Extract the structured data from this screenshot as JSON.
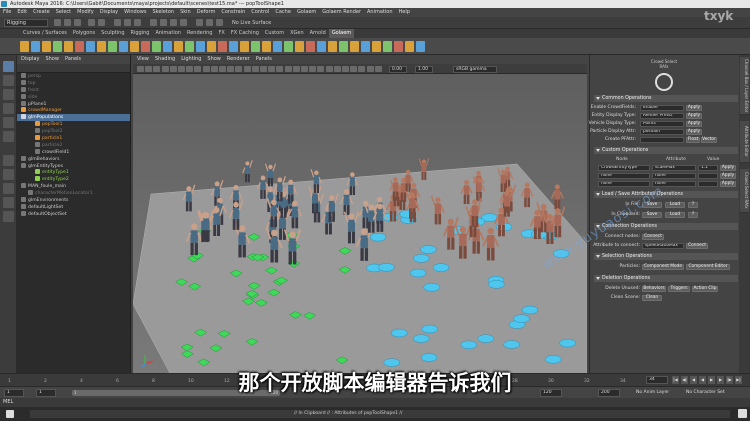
{
  "app": {
    "title": "Autodesk Maya 2016: C:\\Users\\Gabit\\Documents\\maya\\projects\\default\\scenes\\test15.ma* --- popToolShape1"
  },
  "menubar": [
    "File",
    "Edit",
    "Create",
    "Select",
    "Modify",
    "Display",
    "Windows",
    "Skeleton",
    "Skin",
    "Deform",
    "Constrain",
    "Control",
    "Cache",
    "Golaem",
    "Golaem Render",
    "Animation",
    "Help"
  ],
  "status_line": {
    "mode": "Rigging",
    "live_surface": "No Live Surface"
  },
  "shelf_tabs": [
    "Curves / Surfaces",
    "Polygons",
    "Sculpting",
    "Rigging",
    "Animation",
    "Rendering",
    "FX",
    "FX Caching",
    "Custom",
    "XGen",
    "Arnold",
    "Golaem"
  ],
  "shelf_active": "Golaem",
  "outliner": {
    "menu": [
      "Display",
      "Show",
      "Panels"
    ],
    "items": [
      {
        "label": "persp",
        "indent": 0,
        "style": "dim"
      },
      {
        "label": "top",
        "indent": 0,
        "style": "dim"
      },
      {
        "label": "front",
        "indent": 0,
        "style": "dim"
      },
      {
        "label": "side",
        "indent": 0,
        "style": "dim"
      },
      {
        "label": "pPlane1",
        "indent": 0,
        "style": ""
      },
      {
        "label": "crowdManager",
        "indent": 0,
        "style": "orange"
      },
      {
        "label": "glmPopulations",
        "indent": 0,
        "style": "hl"
      },
      {
        "label": "popTool1",
        "indent": 2,
        "style": "orange"
      },
      {
        "label": "popTool2",
        "indent": 2,
        "style": "dim"
      },
      {
        "label": "particle1",
        "indent": 2,
        "style": "orange"
      },
      {
        "label": "particle2",
        "indent": 2,
        "style": "dim"
      },
      {
        "label": "crowdField1",
        "indent": 2,
        "style": ""
      },
      {
        "label": "glmBehaviors",
        "indent": 0,
        "style": ""
      },
      {
        "label": "glmEntityTypes",
        "indent": 0,
        "style": ""
      },
      {
        "label": "entityType1",
        "indent": 2,
        "style": "green"
      },
      {
        "label": "entityType2",
        "indent": 2,
        "style": "green"
      },
      {
        "label": "MAN_foule_main",
        "indent": 0,
        "style": ""
      },
      {
        "label": "characterMotionLocator1",
        "indent": 1,
        "style": "dim"
      },
      {
        "label": "glmEnvironments",
        "indent": 0,
        "style": ""
      },
      {
        "label": "defaultLightSet",
        "indent": 0,
        "style": ""
      },
      {
        "label": "defaultObjectSet",
        "indent": 0,
        "style": ""
      }
    ]
  },
  "viewport": {
    "menu": [
      "View",
      "Shading",
      "Lighting",
      "Show",
      "Renderer",
      "Panels"
    ],
    "field_a": "0.00",
    "field_b": "1.00",
    "color_space": "sRGB gamma"
  },
  "crowd_panel": {
    "logo_caption": "Crowd Select RAfx",
    "common_operations": {
      "title": "Common Operations",
      "enable_crowdfields": {
        "label": "Enable CrowdFields:",
        "value": "Enable",
        "button": "Apply"
      },
      "entity_display_type": {
        "label": "Entity Display Type:",
        "value": "Render Previz",
        "button": "Apply"
      },
      "vehicle_display_type": {
        "label": "Vehicle Display Type:",
        "value": "Points",
        "button": "Apply"
      },
      "particle_display_attr": {
        "label": "Particle Display Attr:",
        "value": "position",
        "button": "Apply"
      },
      "create_pfattr": {
        "label": "Create PFAttr:",
        "btn_float": "Float",
        "btn_vector": "Vector"
      }
    },
    "custom_operations": {
      "title": "Custom Operations",
      "col_node": "Node",
      "col_attribute": "Attribute",
      "col_value": "Value",
      "rows": [
        {
          "node": "CrowdEntityType",
          "attribute": "scaleMax",
          "value": "1.1",
          "button": "Apply"
        },
        {
          "node": "none",
          "attribute": "none",
          "value": "",
          "button": "Apply"
        },
        {
          "node": "none",
          "attribute": "none",
          "value": "",
          "button": "Apply"
        }
      ]
    },
    "load_save": {
      "title": "Load / Save Attributes Operations",
      "in_file": {
        "label": "In File:",
        "save": "Save",
        "load": "Load",
        "help": "?"
      },
      "in_clipboard": {
        "label": "In Clipboard:",
        "save": "Save",
        "load": "Load",
        "help": "?"
      }
    },
    "connection_operations": {
      "title": "Connection Operations",
      "connect_nodes": {
        "label": "Connect nodes:",
        "button": "Connect"
      },
      "attribute_to_connect": {
        "label": "Attribute to connect:",
        "value": "speedRatioMax",
        "button": "Connect"
      }
    },
    "selection_operations": {
      "title": "Selection Operations",
      "particles": {
        "label": "Particles:",
        "btn_component": "Component Mode",
        "btn_editor": "Component Editor"
      }
    },
    "deletion_operations": {
      "title": "Deletion Operations",
      "delete_unused": {
        "label": "Delete Unused:",
        "btn1": "Behaviors",
        "btn2": "Triggers",
        "btn3": "Action Clip"
      },
      "clean_scene": {
        "label": "Clean Scene:",
        "button": "Clean"
      }
    }
  },
  "side_tabs": [
    "Channel Box / Layer Editor",
    "Attribute Editor",
    "Crowd Select RAfx"
  ],
  "time_slider": {
    "ticks": [
      "1",
      "2",
      "4",
      "6",
      "8",
      "10",
      "12",
      "14",
      "16",
      "18",
      "20",
      "22",
      "24",
      "26",
      "28",
      "30",
      "32",
      "34"
    ],
    "current_frame": "34"
  },
  "range_slider": {
    "start": "1",
    "start2": "1",
    "range_start": "1",
    "range_end": "120",
    "end": "120",
    "end2": "200",
    "anim_layer": "No Anim Layer",
    "char_set": "No Character Set"
  },
  "command_line": {
    "label": "MEL"
  },
  "help_line": {
    "text": "// In Clipboard // : Attributes of popToolShape1 //"
  },
  "overlay": {
    "subtitle": "那个开放脚本编辑器告诉我们",
    "watermark": "www.yuyuaosi.com",
    "brandmark": "txyk"
  }
}
